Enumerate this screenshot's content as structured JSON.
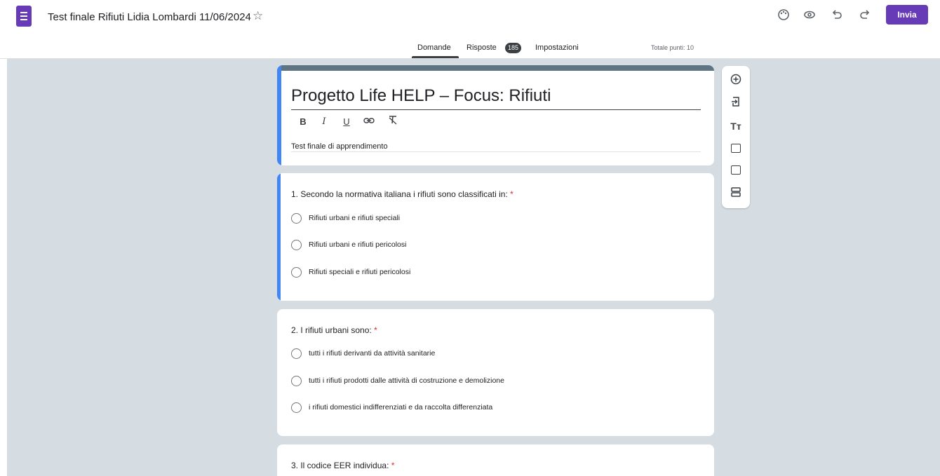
{
  "header": {
    "doc_title": "Test finale Rifiuti Lidia Lombardi 11/06/2024",
    "icons": [
      "forms-app-icon",
      "star-icon",
      "palette-icon",
      "preview-eye-icon",
      "undo-icon",
      "redo-icon"
    ],
    "send_label": "Invia",
    "accent_color": "#673ab7"
  },
  "tabs": {
    "questions": "Domande",
    "responses": "Risposte",
    "responses_count": "185",
    "settings": "Impostazioni",
    "active": "Domande",
    "total_points": "Totale punti: 10"
  },
  "form": {
    "title": "Progetto Life HELP – Focus: Rifiuti",
    "description": "Test finale di apprendimento",
    "format_buttons": [
      "B",
      "I",
      "U",
      "link",
      "clear-format"
    ],
    "theme_color": "#5f7583",
    "background_color": "#d6dde2"
  },
  "questions": [
    {
      "title": "1. Secondo la normativa italiana i rifiuti sono classificati in:",
      "required_mark": "*",
      "options": [
        "Rifiuti urbani e rifiuti speciali",
        "Rifiuti urbani e rifiuti pericolosi",
        "Rifiuti speciali e rifiuti pericolosi"
      ]
    },
    {
      "title": "2. I rifiuti urbani sono:",
      "required_mark": "*",
      "options": [
        "tutti i rifiuti derivanti da attività sanitarie",
        "tutti i rifiuti prodotti dalle attività di costruzione e demolizione",
        "i rifiuti domestici indifferenziati e da raccolta differenziata"
      ]
    },
    {
      "title": "3. Il codice EER individua:",
      "required_mark": "*",
      "options": []
    }
  ],
  "side_toolbar": {
    "icons": [
      "add-question-icon",
      "import-questions-icon",
      "add-title-icon",
      "add-image-icon",
      "add-video-icon",
      "add-section-icon"
    ]
  }
}
